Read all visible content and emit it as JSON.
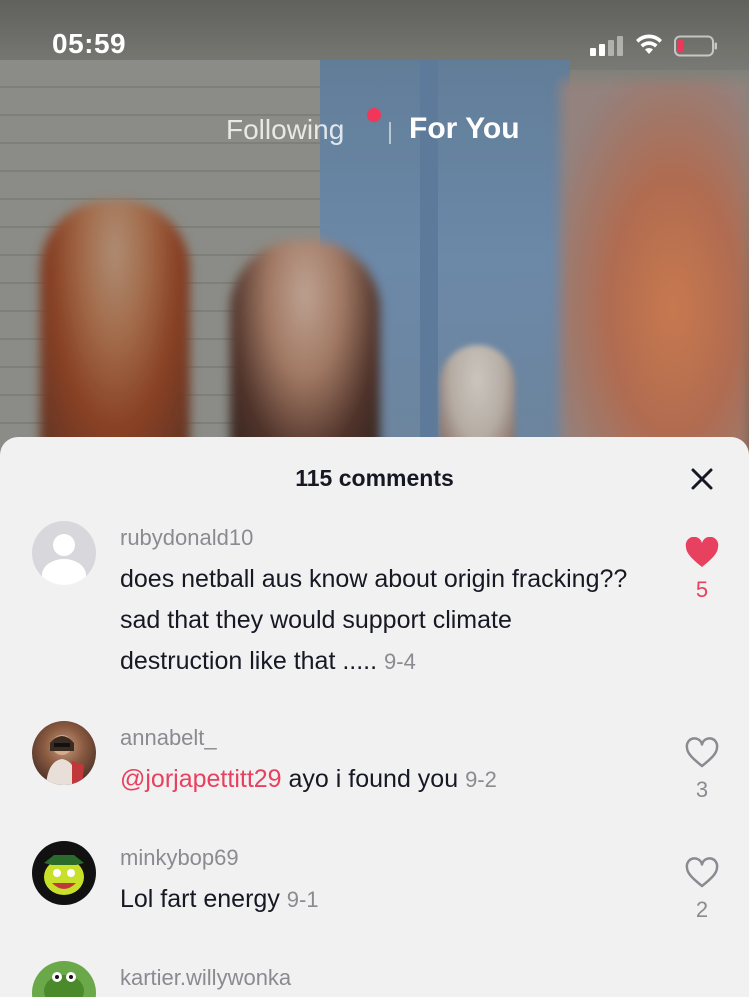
{
  "status_bar": {
    "time": "05:59"
  },
  "top_tabs": {
    "following_label": "Following",
    "for_you_label": "For You"
  },
  "comments_sheet": {
    "title": "115 comments",
    "comments": [
      {
        "username": "rubydonald10",
        "text": "does netball aus know about origin fracking?? sad that they would support climate destruction like that .....",
        "date": "9-4",
        "likes": "5",
        "liked": true,
        "avatar": "default-avatar"
      },
      {
        "username": "annabelt_",
        "mention": "@jorjapettitt29",
        "text": "ayo i found you",
        "date": "9-2",
        "likes": "3",
        "liked": false,
        "avatar": "photo-avatar"
      },
      {
        "username": "minkybop69",
        "text": "Lol fart energy",
        "date": "9-1",
        "likes": "2",
        "liked": false,
        "avatar": "cartoon-avatar"
      },
      {
        "username": "kartier.willywonka",
        "avatar": "cartoon-avatar"
      }
    ]
  },
  "colors": {
    "accent": "#e8415f",
    "live_dot": "#f2365a",
    "sheet_background": "#f2f1f2",
    "text_primary": "#161823",
    "text_secondary": "#8a8b91"
  }
}
